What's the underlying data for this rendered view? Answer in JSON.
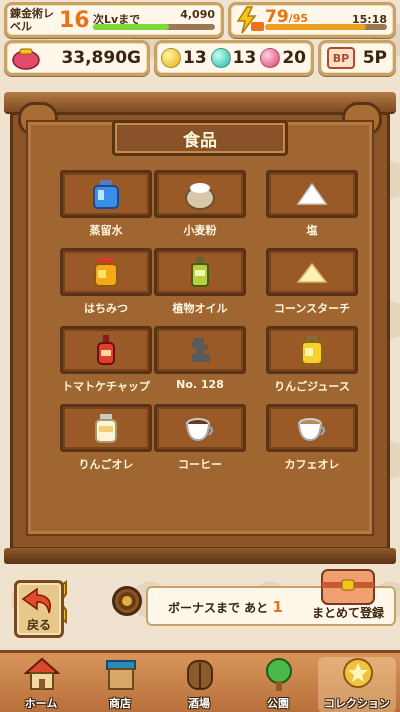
{
  "hud": {
    "level_label": "錬金術レベル",
    "level": "16",
    "next_label": "次Lvまで",
    "next_value": "4,090",
    "exp_progress": 0.62,
    "stamina_current": "79",
    "stamina_max": "/95",
    "stamina_progress": 0.83,
    "clock": "15:18",
    "gold": "33,890G",
    "orb_yellow": "13",
    "orb_teal": "13",
    "orb_pink": "20",
    "bp_badge": "BP",
    "bp_value": "5P"
  },
  "collection": {
    "category": "食品",
    "items": [
      {
        "name": "蒸留水",
        "icon": "blue-water-bottle-icon"
      },
      {
        "name": "小麦粉",
        "icon": "flour-sack-icon"
      },
      {
        "name": "塩",
        "icon": "salt-pile-icon"
      },
      {
        "name": "はちみつ",
        "icon": "honey-jar-icon"
      },
      {
        "name": "植物オイル",
        "icon": "oil-bottle-icon"
      },
      {
        "name": "コーンスターチ",
        "icon": "cornstarch-pile-icon"
      },
      {
        "name": "トマトケチャップ",
        "icon": "ketchup-bottle-icon"
      },
      {
        "name": "No. 128",
        "icon": "unknown-silhouette-icon"
      },
      {
        "name": "りんごジュース",
        "icon": "apple-juice-bottle-icon"
      },
      {
        "name": "りんごオレ",
        "icon": "apple-milk-bottle-icon"
      },
      {
        "name": "コーヒー",
        "icon": "coffee-cup-icon"
      },
      {
        "name": "カフェオレ",
        "icon": "cafe-au-lait-cup-icon"
      }
    ],
    "page_count": 5,
    "current_page": 1
  },
  "actions": {
    "back_label": "戻る",
    "bonus_text": "ボーナスまで あと",
    "bonus_count": "1",
    "bulk_label": "まとめて登録"
  },
  "nav": {
    "items": [
      {
        "label": "ホーム",
        "icon": "home-house-icon"
      },
      {
        "label": "商店",
        "icon": "shop-stall-icon"
      },
      {
        "label": "酒場",
        "icon": "tavern-door-icon"
      },
      {
        "label": "公園",
        "icon": "park-tree-icon"
      },
      {
        "label": "コレクション",
        "icon": "collection-medal-icon"
      }
    ],
    "active_index": 4
  },
  "colors": {
    "accent_orange": "#e8731a",
    "wood_dark": "#5a3314",
    "wood_mid": "#8b5527",
    "cream": "#fff8ea"
  }
}
